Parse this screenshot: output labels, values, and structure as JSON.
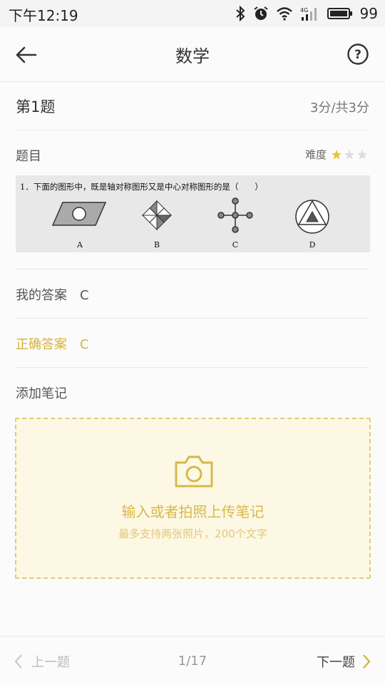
{
  "status_bar": {
    "time": "下午12:19",
    "battery": "99"
  },
  "header": {
    "title": "数学"
  },
  "question": {
    "number_label": "第1题",
    "score": "3分/共3分",
    "section_label": "题目",
    "difficulty_label": "难度",
    "difficulty_stars": 1,
    "difficulty_max": 3,
    "text": "1．下面的图形中，既是轴对称图形又是中心对称图形的是（　　）",
    "options": [
      "A",
      "B",
      "C",
      "D"
    ]
  },
  "answers": {
    "mine_label": "我的答案",
    "mine_value": "C",
    "correct_label": "正确答案",
    "correct_value": "C"
  },
  "notes": {
    "label": "添加笔记",
    "placeholder_main": "输入或者拍照上传笔记",
    "placeholder_sub": "最多支持两张照片，200个文字"
  },
  "footer": {
    "prev_label": "上一题",
    "page": "1/17",
    "next_label": "下一题"
  },
  "colors": {
    "accent": "#d4b43c",
    "star_filled": "#e8c53a",
    "star_empty": "#dddddd"
  }
}
